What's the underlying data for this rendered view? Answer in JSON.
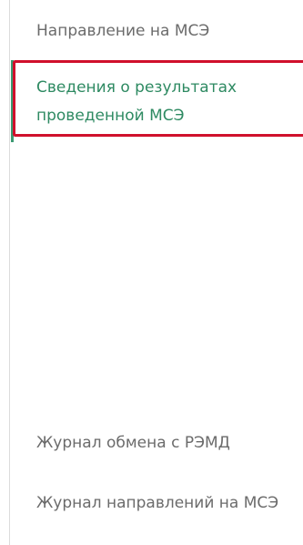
{
  "sidebar": {
    "items": [
      {
        "label": "Направление на МСЭ",
        "active": false
      },
      {
        "label": "Сведения о результатах проведенной МСЭ",
        "active": true
      },
      {
        "label": "Журнал обмена с РЭМД",
        "active": false
      },
      {
        "label": "Журнал направлений на МСЭ",
        "active": false
      }
    ]
  },
  "colors": {
    "text": "#6b6b6b",
    "active_text": "#2e8a62",
    "active_indicator": "#3b9a72",
    "highlight_border": "#d0102c",
    "divider": "#dcdcdc"
  }
}
